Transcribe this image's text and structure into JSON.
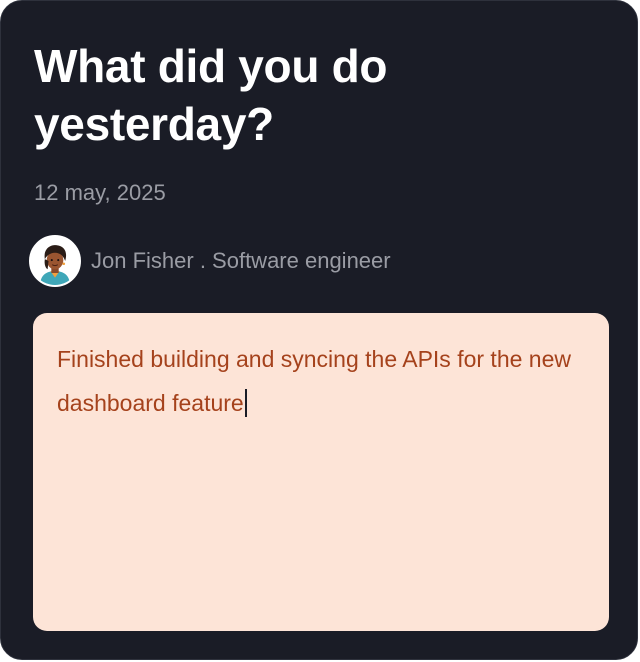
{
  "card": {
    "title": "What did you do yesterday?",
    "date": "12 may, 2025",
    "author": {
      "text": "Jon Fisher . Software engineer",
      "avatar_icon": "person-avatar-icon"
    },
    "note": {
      "value": "Finished building and syncing the APIs for the new dashboard feature"
    }
  },
  "colors": {
    "card_background": "#1a1c26",
    "title": "#ffffff",
    "muted_text": "#9a9ca4",
    "note_background": "#fde4d7",
    "note_text": "#a5421c"
  }
}
